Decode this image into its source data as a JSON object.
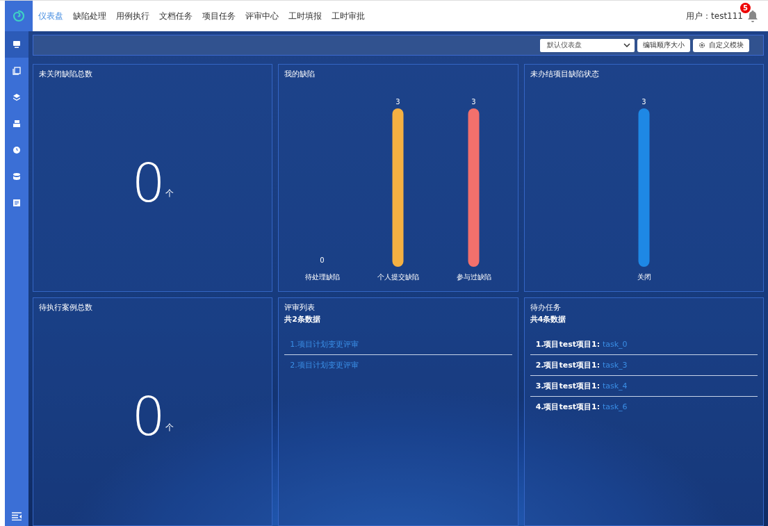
{
  "nav": {
    "items": [
      {
        "label": "仪表盘",
        "selected": true
      },
      {
        "label": "缺陷处理",
        "selected": false
      },
      {
        "label": "用例执行",
        "selected": false
      },
      {
        "label": "文档任务",
        "selected": false
      },
      {
        "label": "项目任务",
        "selected": false
      },
      {
        "label": "评审中心",
        "selected": false
      },
      {
        "label": "工时填报",
        "selected": false
      },
      {
        "label": "工时审批",
        "selected": false
      }
    ],
    "user": "用户：test111",
    "notification_count": "5"
  },
  "sidebar": {
    "items": [
      {
        "kind": "monitor",
        "selected": true
      },
      {
        "kind": "book",
        "selected": false
      },
      {
        "kind": "layers",
        "selected": false
      },
      {
        "kind": "tray",
        "selected": false
      },
      {
        "kind": "clock",
        "selected": false
      },
      {
        "kind": "database",
        "selected": false
      },
      {
        "kind": "document",
        "selected": false
      }
    ]
  },
  "toolbar": {
    "dashboard_select": "默认仪表盘",
    "buttons": [
      {
        "label": "编辑顺序大小",
        "kind": "plain"
      },
      {
        "label": "自定义模块",
        "kind": "gear"
      }
    ]
  },
  "cards": [
    {
      "kind": "number",
      "title": "未关闭缺陷总数",
      "value": "0",
      "unit": "个"
    },
    {
      "kind": "chart",
      "title": "我的缺陷",
      "chart_data": {
        "type": "bar",
        "categories": [
          "待处理缺陷",
          "个人提交缺陷",
          "参与过缺陷"
        ],
        "values": [
          0,
          3,
          3
        ],
        "colors": [
          "#f4b042",
          "#f4b042",
          "#f2706c"
        ],
        "data_labels": true
      }
    },
    {
      "kind": "chart",
      "title": "未办结项目缺陷状态",
      "chart_data": {
        "type": "bar",
        "categories": [
          "关闭"
        ],
        "values": [
          3
        ],
        "colors": [
          "#1e88e5"
        ],
        "data_labels": true
      }
    },
    {
      "kind": "number",
      "title": "待执行案例总数",
      "value": "0",
      "unit": "个"
    },
    {
      "kind": "list",
      "title": "评审列表",
      "count": "共2条数据",
      "items": [
        {
          "link": "1.项目计划变更评审"
        },
        {
          "link": "2.项目计划变更评审"
        }
      ]
    },
    {
      "kind": "list",
      "title": "待办任务",
      "count": "共4条数据",
      "items": [
        {
          "prefix": "1.项目test项目1: ",
          "link": "task_0"
        },
        {
          "prefix": "2.项目test项目1: ",
          "link": "task_3"
        },
        {
          "prefix": "3.项目test项目1: ",
          "link": "task_4"
        },
        {
          "prefix": "4.项目test项目1: ",
          "link": "task_6"
        }
      ]
    }
  ]
}
